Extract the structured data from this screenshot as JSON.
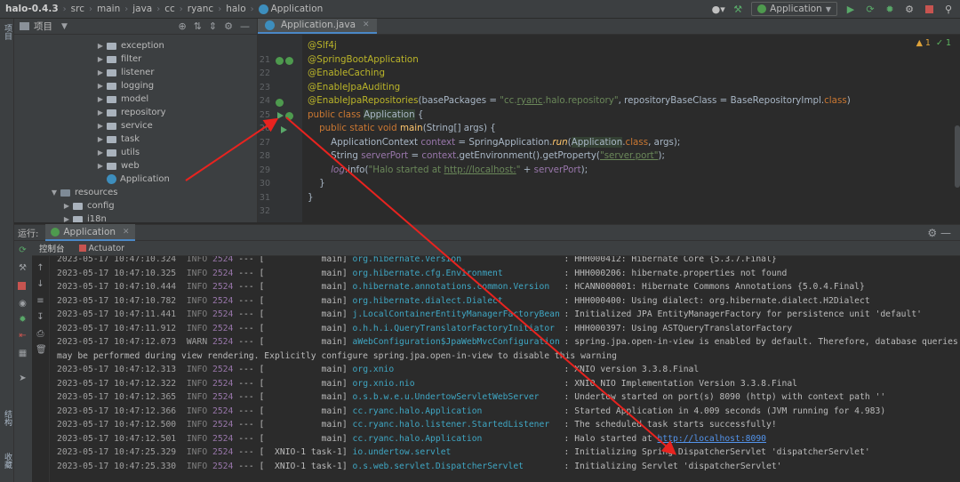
{
  "breadcrumb": [
    "halo-0.4.3",
    "src",
    "main",
    "java",
    "cc",
    "ryanc",
    "halo",
    "Application"
  ],
  "run_config": {
    "label": "Application"
  },
  "left_strip": {
    "top_tab": "项目",
    "bottom_tab_1": "结构",
    "bottom_tab_2": "收藏"
  },
  "project_panel": {
    "title": "项目",
    "tree": [
      {
        "label": "exception",
        "kind": "folder",
        "depth": 3
      },
      {
        "label": "filter",
        "kind": "folder",
        "depth": 3
      },
      {
        "label": "listener",
        "kind": "folder",
        "depth": 3
      },
      {
        "label": "logging",
        "kind": "folder",
        "depth": 3
      },
      {
        "label": "model",
        "kind": "folder",
        "depth": 3
      },
      {
        "label": "repository",
        "kind": "folder",
        "depth": 3
      },
      {
        "label": "service",
        "kind": "folder",
        "depth": 3
      },
      {
        "label": "task",
        "kind": "folder",
        "depth": 3
      },
      {
        "label": "utils",
        "kind": "folder",
        "depth": 3
      },
      {
        "label": "web",
        "kind": "folder",
        "depth": 3
      },
      {
        "label": "Application",
        "kind": "class",
        "depth": 3
      },
      {
        "label": "resources",
        "kind": "folder-open",
        "depth": 1
      },
      {
        "label": "config",
        "kind": "folder",
        "depth": 2
      },
      {
        "label": "i18n",
        "kind": "folder",
        "depth": 2
      }
    ]
  },
  "editor": {
    "tab_label": "Application.java",
    "inspections": {
      "warnings": "1",
      "ok": "1"
    },
    "line_numbers": [
      "",
      "21",
      "22",
      "23",
      "24",
      "25",
      "26",
      "27",
      "28",
      "29",
      "30",
      "31",
      "32"
    ],
    "code": {
      "l0": "@Slf4j",
      "l1": "@SpringBootApplication",
      "l2": "@EnableCaching",
      "l3": "@EnableJpaAuditing",
      "l4a": "@EnableJpaRepositories",
      "l4b": "(basePackages = ",
      "l4c": "\"cc.",
      "l4d": "ryanc",
      "l4e": ".halo.repository\"",
      "l4f": ", repositoryBaseClass = BaseRepositoryImpl.",
      "l4g": "class",
      "l4h": ")",
      "l5a": "public class ",
      "l5b": "Application",
      "l5c": " {",
      "l6a": "    public static void ",
      "l6b": "main",
      "l6c": "(String[] args) {",
      "l7a": "        ApplicationContext ",
      "l7b": "context",
      "l7c": " = SpringApplication.",
      "l7d": "run",
      "l7e": "(",
      "l7f": "Application",
      "l7g": ".",
      "l7h": "class",
      "l7i": ", args);",
      "l8a": "        String ",
      "l8b": "serverPort",
      "l8c": " = ",
      "l8d": "context",
      "l8e": ".getEnvironment().getProperty(",
      "l8f": "\"server.port\"",
      "l8g": ");",
      "l9a": "        ",
      "l9b": "log",
      "l9c": ".info(",
      "l9d": "\"Halo started at ",
      "l9e": "http://localhost:",
      "l9f": "\"",
      "l9g": " + ",
      "l9h": "serverPort",
      "l9i": ");",
      "l10": "    }",
      "l11": "}"
    }
  },
  "run_panel": {
    "label": "运行:",
    "tab_label": "Application",
    "subtabs": {
      "console": "控制台",
      "actuator": "Actuator"
    }
  },
  "console": {
    "lines": [
      {
        "date": "2023-05-17 10:47:10.324",
        "level": "INFO",
        "pid": "2524",
        "sep": "---",
        "thread": "[           main]",
        "logger": "org.hibernate.Version",
        "msg": ": HHH000412: Hibernate Core {5.3.7.Final}"
      },
      {
        "date": "2023-05-17 10:47:10.325",
        "level": "INFO",
        "pid": "2524",
        "sep": "---",
        "thread": "[           main]",
        "logger": "org.hibernate.cfg.Environment",
        "msg": ": HHH000206: hibernate.properties not found"
      },
      {
        "date": "2023-05-17 10:47:10.444",
        "level": "INFO",
        "pid": "2524",
        "sep": "---",
        "thread": "[           main]",
        "logger": "o.hibernate.annotations.common.Version",
        "msg": ": HCANN000001: Hibernate Commons Annotations {5.0.4.Final}"
      },
      {
        "date": "2023-05-17 10:47:10.782",
        "level": "INFO",
        "pid": "2524",
        "sep": "---",
        "thread": "[           main]",
        "logger": "org.hibernate.dialect.Dialect",
        "msg": ": HHH000400: Using dialect: org.hibernate.dialect.H2Dialect"
      },
      {
        "date": "2023-05-17 10:47:11.441",
        "level": "INFO",
        "pid": "2524",
        "sep": "---",
        "thread": "[           main]",
        "logger": "j.LocalContainerEntityManagerFactoryBean",
        "msg": ": Initialized JPA EntityManagerFactory for persistence unit 'default'"
      },
      {
        "date": "2023-05-17 10:47:11.912",
        "level": "INFO",
        "pid": "2524",
        "sep": "---",
        "thread": "[           main]",
        "logger": "o.h.h.i.QueryTranslatorFactoryInitiator",
        "msg": ": HHH000397: Using ASTQueryTranslatorFactory"
      },
      {
        "date": "2023-05-17 10:47:12.073",
        "level": "WARN",
        "pid": "2524",
        "sep": "---",
        "thread": "[           main]",
        "logger": "aWebConfiguration$JpaWebMvcConfiguration",
        "msg": ": spring.jpa.open-in-view is enabled by default. Therefore, database queries"
      },
      {
        "cont": "may be performed during view rendering. Explicitly configure spring.jpa.open-in-view to disable this warning"
      },
      {
        "date": "2023-05-17 10:47:12.313",
        "level": "INFO",
        "pid": "2524",
        "sep": "---",
        "thread": "[           main]",
        "logger": "org.xnio",
        "msg": ": XNIO version 3.3.8.Final"
      },
      {
        "date": "2023-05-17 10:47:12.322",
        "level": "INFO",
        "pid": "2524",
        "sep": "---",
        "thread": "[           main]",
        "logger": "org.xnio.nio",
        "msg": ": XNIO NIO Implementation Version 3.3.8.Final"
      },
      {
        "date": "2023-05-17 10:47:12.365",
        "level": "INFO",
        "pid": "2524",
        "sep": "---",
        "thread": "[           main]",
        "logger": "o.s.b.w.e.u.UndertowServletWebServer",
        "msg": ": Undertow started on port(s) 8090 (http) with context path ''"
      },
      {
        "date": "2023-05-17 10:47:12.366",
        "level": "INFO",
        "pid": "2524",
        "sep": "---",
        "thread": "[           main]",
        "logger": "cc.ryanc.halo.Application",
        "msg": ": Started Application in 4.009 seconds (JVM running for 4.983)"
      },
      {
        "date": "2023-05-17 10:47:12.500",
        "level": "INFO",
        "pid": "2524",
        "sep": "---",
        "thread": "[           main]",
        "logger": "cc.ryanc.halo.listener.StartedListener",
        "msg": ": The scheduled task starts successfully!"
      },
      {
        "date": "2023-05-17 10:47:12.501",
        "level": "INFO",
        "pid": "2524",
        "sep": "---",
        "thread": "[           main]",
        "logger": "cc.ryanc.halo.Application",
        "msg": ": Halo started at ",
        "url": "http://localhost:8090"
      },
      {
        "date": "2023-05-17 10:47:25.329",
        "level": "INFO",
        "pid": "2524",
        "sep": "---",
        "thread": "[  XNIO-1 task-1]",
        "logger": "io.undertow.servlet",
        "msg": ": Initializing Spring DispatcherServlet 'dispatcherServlet'"
      },
      {
        "date": "2023-05-17 10:47:25.330",
        "level": "INFO",
        "pid": "2524",
        "sep": "---",
        "thread": "[  XNIO-1 task-1]",
        "logger": "o.s.web.servlet.DispatcherServlet",
        "msg": ": Initializing Servlet 'dispatcherServlet'"
      }
    ]
  },
  "colors": {
    "annotation_arrow": "#e8231f",
    "accent": "#4a88c7"
  }
}
